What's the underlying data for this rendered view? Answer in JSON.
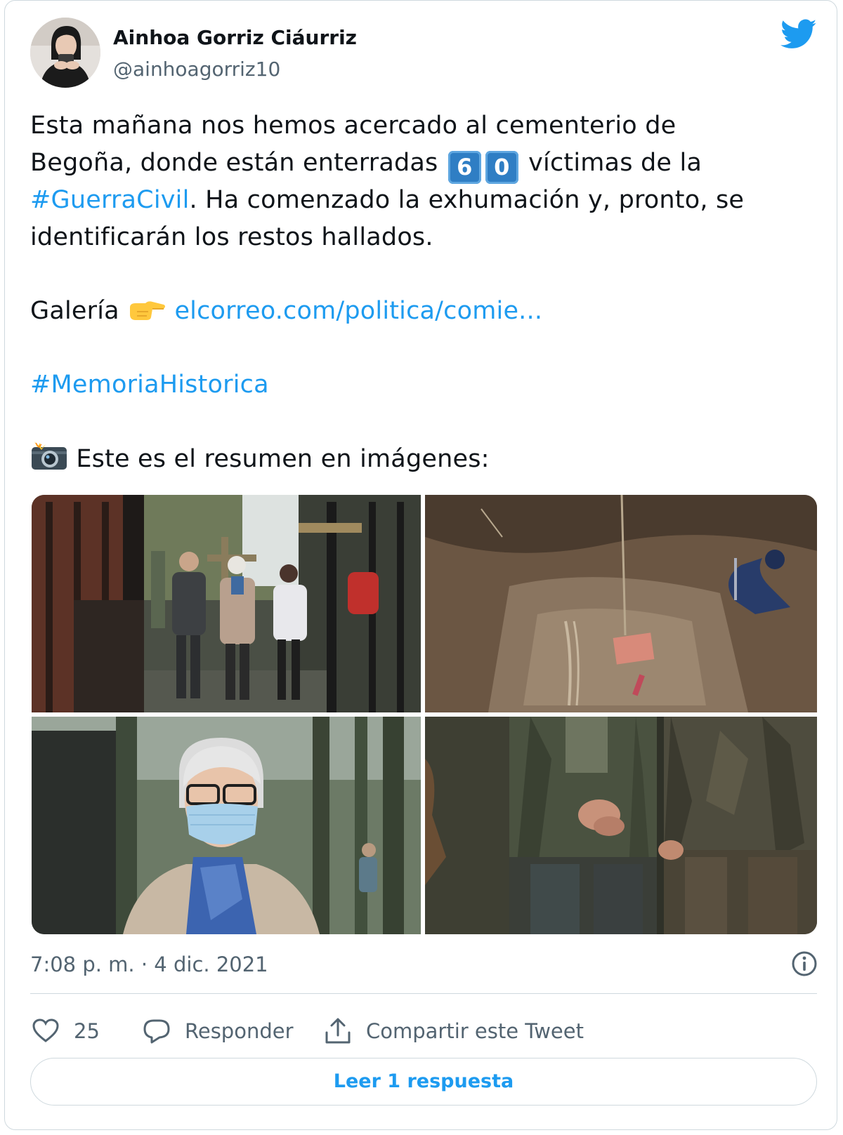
{
  "author": {
    "name": "Ainhoa Gorriz Ciáurriz",
    "handle": "@ainhoagorriz10"
  },
  "tweet": {
    "line1": "Esta mañana nos hemos acercado al cementerio de",
    "line2_before": "Begoña, donde están enterradas ",
    "keycap_1": "6",
    "keycap_2": "0",
    "line2_after": " víctimas de la",
    "hashtag1": "#GuerraCivil",
    "line3_after": ". Ha comenzado la exhumación y, pronto, se",
    "line4": "identificarán los restos hallados.",
    "gallery_label": "Galería",
    "gallery_link": "elcorreo.com/politica/comie...",
    "hashtag2": "#MemoriaHistorica",
    "summary": "Este es el resumen en imágenes:"
  },
  "icons": {
    "pointing": "backhand-index-pointing-right-emoji",
    "camera": "camera-with-flash-emoji",
    "brand": "twitter-bird-icon",
    "info": "info-icon",
    "like": "heart-icon",
    "reply": "speech-bubble-icon",
    "share": "share-upload-icon"
  },
  "photos": [
    "cemetery-gate-people-photo",
    "excavation-pit-photo",
    "elderly-woman-mask-photo",
    "muddy-workers-hands-photo"
  ],
  "meta": {
    "timestamp": "7:08 p. m. · 4 dic. 2021"
  },
  "actions": {
    "like_count": "25",
    "reply_label": "Responder",
    "share_label": "Compartir este Tweet"
  },
  "footer": {
    "read_replies": "Leer 1 respuesta"
  },
  "colors": {
    "link": "#1d9bf0",
    "text": "#0f1419",
    "secondary": "#536471",
    "border": "#cfd9de",
    "keycap": "#2f7ec4"
  }
}
